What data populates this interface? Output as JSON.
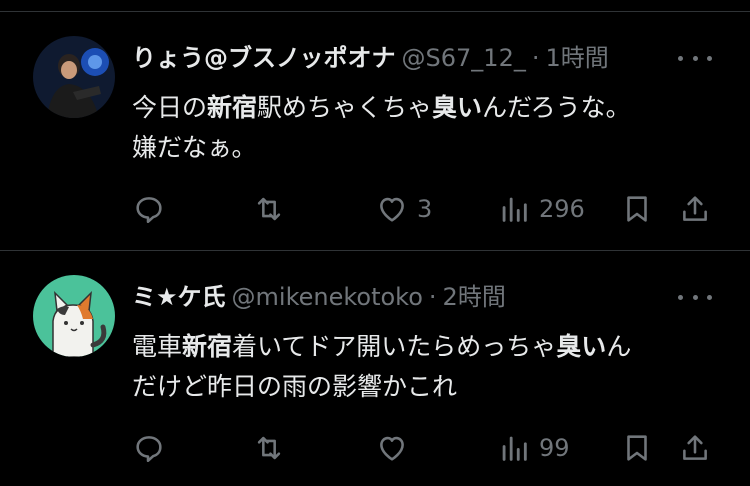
{
  "tweets": [
    {
      "display_name": "りょう@ブスノッポオナ",
      "handle": "@S67_12_",
      "separator": "·",
      "time": "1時間",
      "text_parts": [
        "今日の",
        "新宿",
        "駅めちゃくちゃ",
        "臭い",
        "んだろうな。",
        "嫌だなぁ。"
      ],
      "likes": "3",
      "views": "296",
      "avatar_colors": {
        "bg": "#1a2540",
        "accent": "#2f7fff"
      }
    },
    {
      "display_name": "ミ★ケ氏",
      "handle": "@mikenekotoko",
      "separator": "·",
      "time": "2時間",
      "text_parts": [
        "電車",
        "新宿",
        "着いてドア開いたらめっちゃ",
        "臭い",
        "ん",
        "だけど昨日の雨の影響かこれ"
      ],
      "likes": "",
      "views": "99",
      "avatar_colors": {
        "bg": "#4bc29a",
        "accent": "#e07a2e"
      }
    }
  ],
  "colors": {
    "background": "#000000",
    "text": "#e7e9ea",
    "muted": "#71767b",
    "divider": "#2f3336"
  },
  "icons": [
    "reply-icon",
    "retweet-icon",
    "like-icon",
    "views-icon",
    "bookmark-icon",
    "share-icon",
    "more-icon"
  ]
}
